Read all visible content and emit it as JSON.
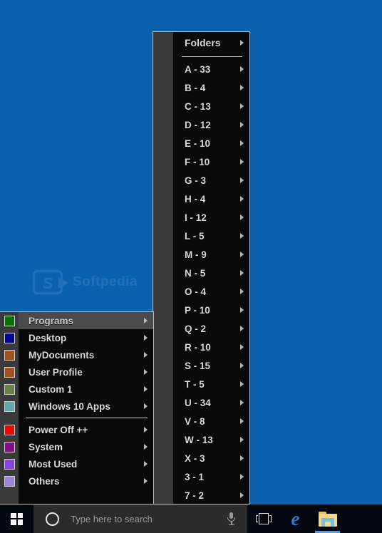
{
  "desktop": {
    "background_color": "#0a62ad",
    "watermark": {
      "mark_letter": "S",
      "text": "Softpedia"
    }
  },
  "folders_menu": {
    "header": {
      "label": "Folders",
      "icon": "folder-icon",
      "arrow": "chevron-right-icon"
    },
    "items": [
      {
        "label": "A - 33",
        "arrow": "chevron-right-icon"
      },
      {
        "label": "B - 4",
        "arrow": "chevron-right-icon"
      },
      {
        "label": "C - 13",
        "arrow": "chevron-right-icon"
      },
      {
        "label": "D - 12",
        "arrow": "chevron-right-icon"
      },
      {
        "label": "E - 10",
        "arrow": "chevron-right-icon"
      },
      {
        "label": "F - 10",
        "arrow": "chevron-right-icon"
      },
      {
        "label": "G - 3",
        "arrow": "chevron-right-icon"
      },
      {
        "label": "H - 4",
        "arrow": "chevron-right-icon"
      },
      {
        "label": "I - 12",
        "arrow": "chevron-right-icon"
      },
      {
        "label": "L - 5",
        "arrow": "chevron-right-icon"
      },
      {
        "label": "M - 9",
        "arrow": "chevron-right-icon"
      },
      {
        "label": "N - 5",
        "arrow": "chevron-right-icon"
      },
      {
        "label": "O - 4",
        "arrow": "chevron-right-icon"
      },
      {
        "label": "P - 10",
        "arrow": "chevron-right-icon"
      },
      {
        "label": "Q - 2",
        "arrow": "chevron-right-icon"
      },
      {
        "label": "R - 10",
        "arrow": "chevron-right-icon"
      },
      {
        "label": "S - 15",
        "arrow": "chevron-right-icon"
      },
      {
        "label": "T - 5",
        "arrow": "chevron-right-icon"
      },
      {
        "label": "U - 34",
        "arrow": "chevron-right-icon"
      },
      {
        "label": "V - 8",
        "arrow": "chevron-right-icon"
      },
      {
        "label": "W - 13",
        "arrow": "chevron-right-icon"
      },
      {
        "label": "X - 3",
        "arrow": "chevron-right-icon"
      },
      {
        "label": "3 - 1",
        "arrow": "chevron-right-icon"
      },
      {
        "label": "7 - 2",
        "arrow": "chevron-right-icon"
      }
    ]
  },
  "left_menu": {
    "items": [
      {
        "label": "Programs",
        "swatch": "#067106",
        "selected": true,
        "arrow": "chevron-right-icon"
      },
      {
        "label": "Desktop",
        "swatch": "#060690",
        "selected": false,
        "arrow": "chevron-right-icon"
      },
      {
        "label": "MyDocuments",
        "swatch": "#a4521d",
        "selected": false,
        "arrow": "chevron-right-icon"
      },
      {
        "label": "User Profile",
        "swatch": "#a4521d",
        "selected": false,
        "arrow": "chevron-right-icon"
      },
      {
        "label": "Custom 1",
        "swatch": "#6c8045",
        "selected": false,
        "arrow": "chevron-right-icon"
      },
      {
        "label": "Windows 10 Apps",
        "swatch": "#63a7a8",
        "selected": false,
        "arrow": "chevron-right-icon"
      }
    ],
    "items_group2": [
      {
        "label": "Power Off ++",
        "swatch": "#fc0000",
        "selected": false,
        "arrow": "chevron-right-icon"
      },
      {
        "label": "System",
        "swatch": "#8a0c8c",
        "selected": false,
        "arrow": "chevron-right-icon"
      },
      {
        "label": "Most Used",
        "swatch": "#8a41e8",
        "selected": false,
        "arrow": "chevron-right-icon"
      },
      {
        "label": "Others",
        "swatch": "#9d85e2",
        "selected": false,
        "arrow": "chevron-right-icon"
      }
    ]
  },
  "taskbar": {
    "start_button": {
      "label": "Start",
      "icon": "windows-logo-icon"
    },
    "search": {
      "icon": "cortana-circle-icon",
      "placeholder": "Type here to search",
      "value": "",
      "mic_icon": "microphone-icon"
    },
    "buttons": [
      {
        "name": "task-view",
        "icon": "task-view-icon",
        "label": "Task View",
        "active": false
      },
      {
        "name": "edge",
        "icon": "edge-browser-icon",
        "label": "Microsoft Edge",
        "glyph": "e",
        "active": false
      },
      {
        "name": "file-explorer",
        "icon": "file-explorer-icon",
        "label": "File Explorer",
        "active": true
      }
    ]
  }
}
